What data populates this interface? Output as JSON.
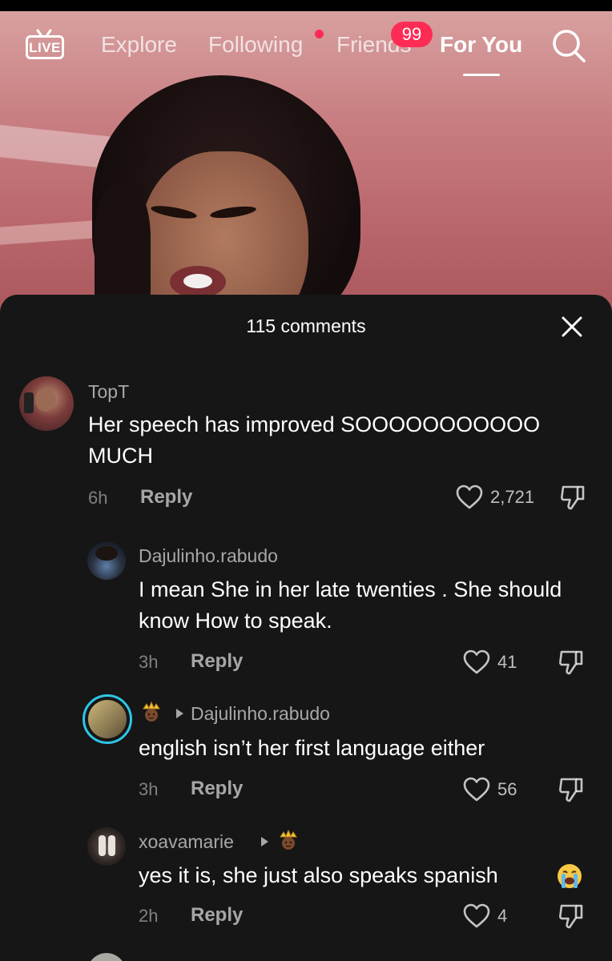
{
  "nav": {
    "live_label": "LIVE",
    "tabs": [
      {
        "label": "Explore"
      },
      {
        "label": "Following"
      },
      {
        "label": "Friends"
      },
      {
        "label": "For You"
      }
    ],
    "friends_badge": "99",
    "active_tab": "For You"
  },
  "comments_sheet": {
    "title": "115 comments",
    "comments": [
      {
        "username": "TopT",
        "text": "Her speech has improved SOOOOOOOOOOO MUCH",
        "time": "6h",
        "reply_label": "Reply",
        "likes": "2,721"
      },
      {
        "username": "Dajulinho.rabudo",
        "text": "I mean She in her late twenties . She should know How to speak.",
        "time": "3h",
        "reply_label": "Reply",
        "likes": "41"
      },
      {
        "username": "",
        "reply_to": "Dajulinho.rabudo",
        "text": "english isn’t her first language either",
        "time": "3h",
        "reply_label": "Reply",
        "likes": "56"
      },
      {
        "username": "xoavamarie",
        "text": "yes it is, she just also speaks spanish",
        "time": "2h",
        "reply_label": "Reply",
        "likes": "4"
      }
    ]
  },
  "colors": {
    "accent": "#fe2c55",
    "sheet_bg": "#161616",
    "story_ring": "#2ec6e6"
  },
  "icons": [
    "live-icon",
    "search-icon",
    "close-icon",
    "heart-icon",
    "dislike-icon",
    "crown-icon",
    "arrow-right-icon",
    "crying-face-icon"
  ]
}
